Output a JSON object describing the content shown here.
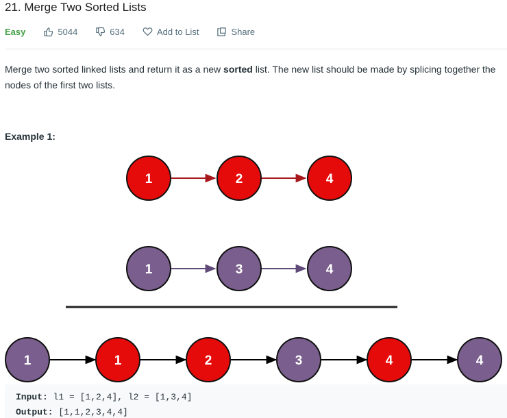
{
  "problem": {
    "title": "21. Merge Two Sorted Lists",
    "difficulty": "Easy",
    "likes": "5044",
    "dislikes": "634",
    "add_to_list": "Add to List",
    "share": "Share"
  },
  "description": {
    "part1": "Merge two sorted linked lists and return it as a new ",
    "bold": "sorted",
    "part2": " list. The new list should be made by splicing together the nodes of the first two lists."
  },
  "example": {
    "label": "Example 1:",
    "input_label": "Input:",
    "input_value": " l1 = [1,2,4], l2 = [1,3,4]",
    "output_label": "Output:",
    "output_value": " [1,1,2,3,4,4]"
  },
  "diagram": {
    "list1": [
      "1",
      "2",
      "4"
    ],
    "list2": [
      "1",
      "3",
      "4"
    ],
    "merged": [
      {
        "value": "1",
        "list": "l2"
      },
      {
        "value": "1",
        "list": "l1"
      },
      {
        "value": "2",
        "list": "l1"
      },
      {
        "value": "3",
        "list": "l2"
      },
      {
        "value": "4",
        "list": "l1"
      },
      {
        "value": "4",
        "list": "l2"
      }
    ],
    "colors": {
      "l1_fill": "#e60b0b",
      "l2_fill": "#7a5f8e",
      "l1_arrow": "#a8171b",
      "l2_arrow": "#5f4a78",
      "merged_arrow": "#000000"
    }
  },
  "icons": {
    "like": "thumbs-up-icon",
    "dislike": "thumbs-down-icon",
    "add": "heart-icon",
    "share": "share-icon"
  }
}
